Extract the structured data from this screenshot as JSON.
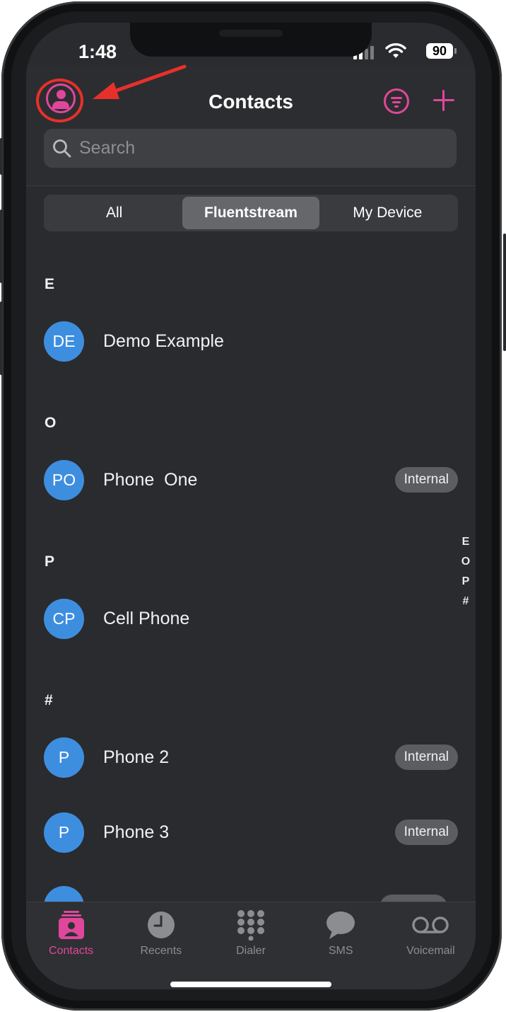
{
  "status_bar": {
    "time": "1:48",
    "battery": "90"
  },
  "header": {
    "title": "Contacts"
  },
  "search": {
    "placeholder": "Search"
  },
  "segments": [
    {
      "label": "All",
      "active": false
    },
    {
      "label": "Fluentstream",
      "active": true
    },
    {
      "label": "My Device",
      "active": false
    }
  ],
  "sections": [
    {
      "letter": "E",
      "contacts": [
        {
          "initials": "DE",
          "name": "Demo Example",
          "badge": ""
        }
      ]
    },
    {
      "letter": "O",
      "contacts": [
        {
          "initials": "PO",
          "name": "Phone  One",
          "badge": "Internal"
        }
      ]
    },
    {
      "letter": "P",
      "contacts": [
        {
          "initials": "CP",
          "name": "Cell Phone",
          "badge": ""
        }
      ]
    },
    {
      "letter": "#",
      "contacts": [
        {
          "initials": "P",
          "name": "Phone 2",
          "badge": "Internal"
        },
        {
          "initials": "P",
          "name": "Phone 3",
          "badge": "Internal"
        }
      ]
    }
  ],
  "index_rail": [
    "E",
    "O",
    "P",
    "#"
  ],
  "tabs": [
    {
      "label": "Contacts",
      "icon": "contacts-icon",
      "active": true
    },
    {
      "label": "Recents",
      "icon": "clock-icon",
      "active": false
    },
    {
      "label": "Dialer",
      "icon": "keypad-icon",
      "active": false
    },
    {
      "label": "SMS",
      "icon": "chat-bubble-icon",
      "active": false
    },
    {
      "label": "Voicemail",
      "icon": "voicemail-icon",
      "active": false
    }
  ],
  "colors": {
    "accent": "#e0479b",
    "avatar": "#3e8ee0",
    "annotation": "#e8302b",
    "background": "#2a2b2e"
  }
}
